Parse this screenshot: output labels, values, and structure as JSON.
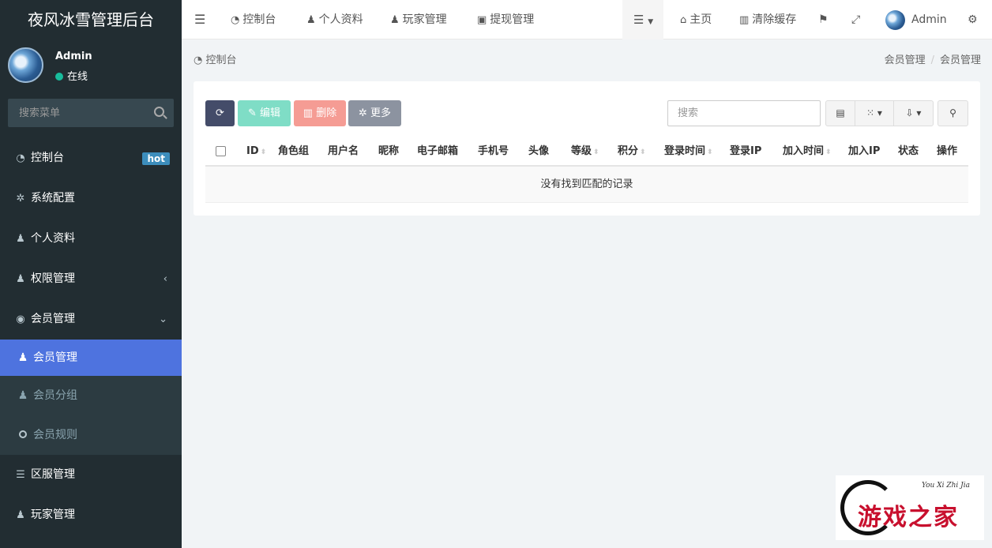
{
  "brand": "夜风冰雪管理后台",
  "user": {
    "name": "Admin",
    "status": "在线"
  },
  "sidebar_search": {
    "placeholder": "搜索菜单"
  },
  "menu": {
    "dashboard": "控制台",
    "dashboard_badge": "hot",
    "config": "系统配置",
    "profile": "个人资料",
    "auth": "权限管理",
    "member": "会员管理",
    "sub_member": "会员管理",
    "sub_group": "会员分组",
    "sub_rule": "会员规则",
    "server": "区服管理",
    "player": "玩家管理"
  },
  "topnav": {
    "dashboard": "控制台",
    "profile": "个人资料",
    "player": "玩家管理",
    "withdraw": "提现管理",
    "home": "主页",
    "clear_cache": "清除缓存",
    "admin": "Admin"
  },
  "breadcrumb": {
    "left": "控制台",
    "right_1": "会员管理",
    "right_2": "会员管理"
  },
  "toolbar": {
    "edit": "编辑",
    "delete": "删除",
    "more": "更多",
    "search_placeholder": "搜索"
  },
  "table": {
    "columns": [
      "ID",
      "角色组",
      "用户名",
      "昵称",
      "电子邮箱",
      "手机号",
      "头像",
      "等级",
      "积分",
      "登录时间",
      "登录IP",
      "加入时间",
      "加入IP",
      "状态",
      "操作"
    ],
    "empty_text": "没有找到匹配的记录"
  },
  "watermark": {
    "sub": "You Xi Zhi Jia",
    "main": "游戏之家"
  },
  "colors": {
    "sidebar": "#222d32",
    "active": "#4e73df",
    "refresh": "#444c69",
    "edit": "#7fddc6",
    "delete": "#f59c94",
    "more": "#8c93a0",
    "badge": "#3c8dbc"
  }
}
